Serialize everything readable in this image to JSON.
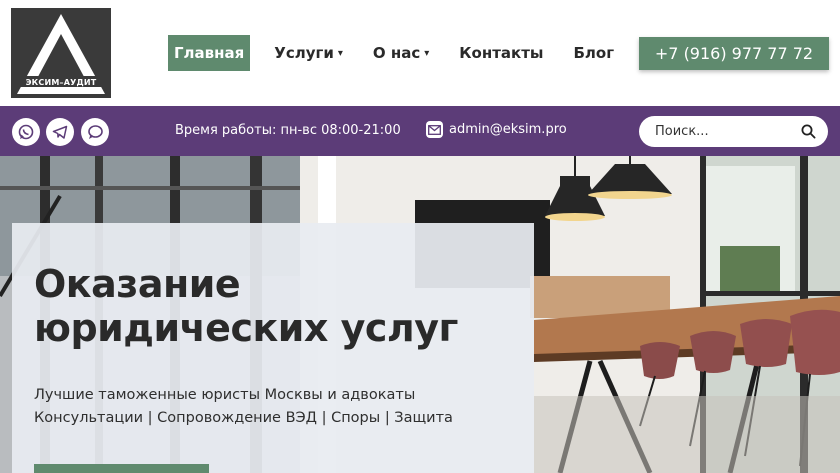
{
  "logo": {
    "text": "ЭКСИМ–АУДИТ"
  },
  "nav": {
    "items": [
      {
        "label": "Главная",
        "active": true,
        "dropdown": false
      },
      {
        "label": "Услуги",
        "active": false,
        "dropdown": true
      },
      {
        "label": "О нас",
        "active": false,
        "dropdown": true
      },
      {
        "label": "Контакты",
        "active": false,
        "dropdown": false
      },
      {
        "label": "Блог",
        "active": false,
        "dropdown": false
      }
    ],
    "caret": "▾"
  },
  "phone": "+7 (916) 977 77 72",
  "topbar": {
    "social": [
      "whatsapp-icon",
      "telegram-icon",
      "chat-icon"
    ],
    "hours": "Время работы: пн-вс 08:00-21:00",
    "email": "admin@eksim.pro"
  },
  "search": {
    "placeholder": "Поиск..."
  },
  "hero": {
    "title_line1": "Оказание",
    "title_line2": "юридических услуг",
    "subtitle_line1": "Лучшие таможенные юристы Москвы и адвокаты",
    "subtitle_line2": "Консультации | Сопровождение ВЭД | Споры | Защита"
  },
  "colors": {
    "accent_green": "#5f8a6e",
    "bar_purple": "#5c3c78",
    "logo_dark": "#3a3a3a"
  }
}
